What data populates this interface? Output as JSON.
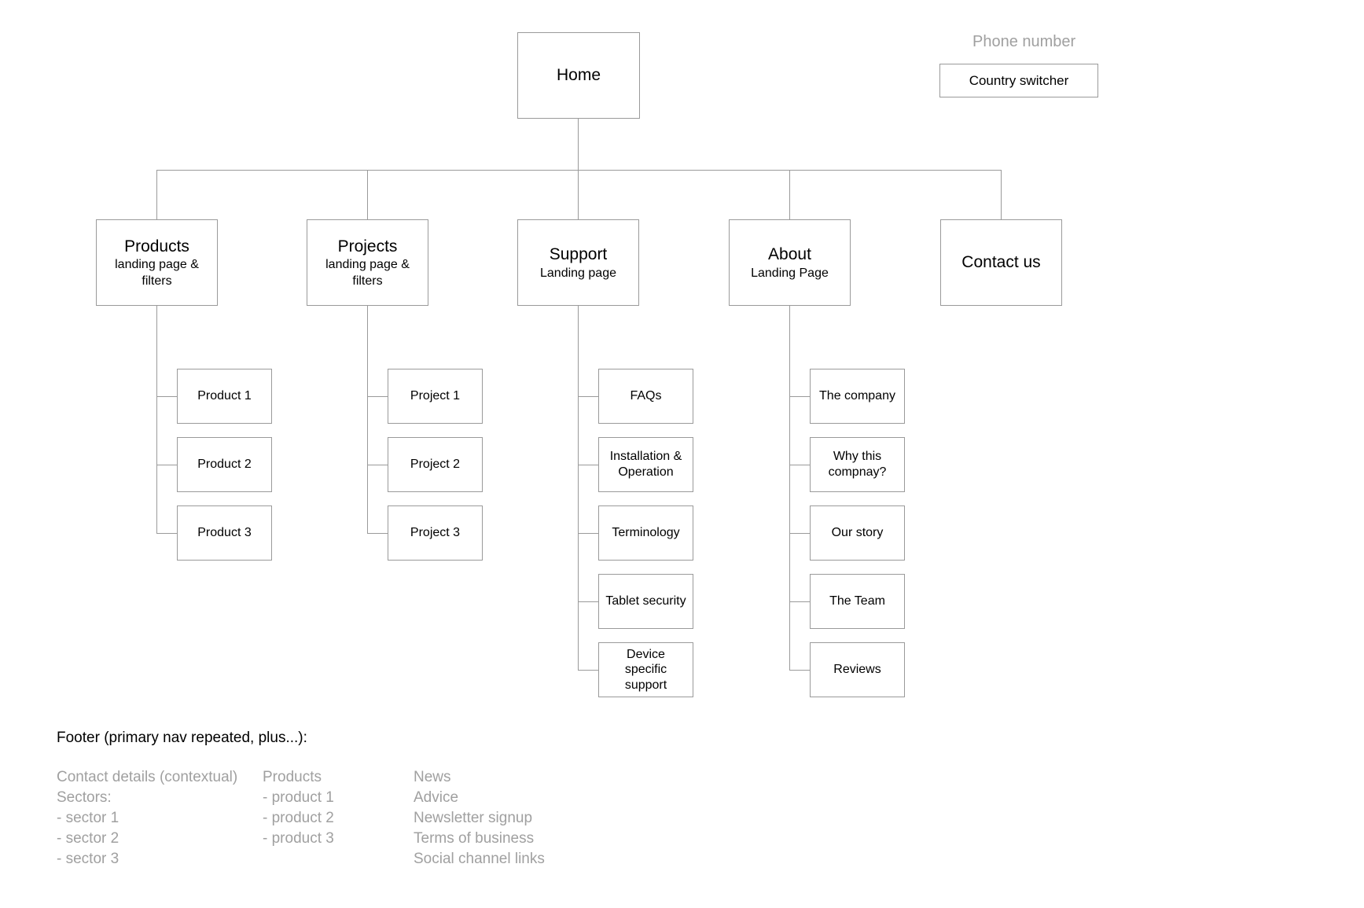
{
  "diagram": {
    "type": "sitemap-tree",
    "root": {
      "label": "Home"
    },
    "header_extras": {
      "phone_number": "Phone number",
      "country_switcher": "Country switcher"
    },
    "level2": [
      {
        "label": "Products",
        "sub_line1": "landing page &",
        "sub_line2": "filters"
      },
      {
        "label": "Projects",
        "sub_line1": "landing page &",
        "sub_line2": "filters"
      },
      {
        "label": "Support",
        "sub_line1": "Landing page",
        "sub_line2": ""
      },
      {
        "label": "About",
        "sub_line1": "Landing Page",
        "sub_line2": ""
      },
      {
        "label": "Contact us",
        "sub_line1": "",
        "sub_line2": ""
      }
    ],
    "products_children": [
      {
        "label": "Product 1"
      },
      {
        "label": "Product 2"
      },
      {
        "label": "Product 3"
      }
    ],
    "projects_children": [
      {
        "label": "Project 1"
      },
      {
        "label": "Project 2"
      },
      {
        "label": "Project 3"
      }
    ],
    "support_children": [
      {
        "line1": "FAQs",
        "line2": "",
        "line3": ""
      },
      {
        "line1": "Installation &",
        "line2": "Operation",
        "line3": ""
      },
      {
        "line1": "Terminology",
        "line2": "",
        "line3": ""
      },
      {
        "line1": "Tablet security",
        "line2": "",
        "line3": ""
      },
      {
        "line1": "Device",
        "line2": "specific",
        "line3": "support"
      }
    ],
    "about_children": [
      {
        "line1": "The company",
        "line2": ""
      },
      {
        "line1": "Why this",
        "line2": "compnay?"
      },
      {
        "line1": "Our story",
        "line2": ""
      },
      {
        "line1": "The Team",
        "line2": ""
      },
      {
        "line1": "Reviews",
        "line2": ""
      }
    ]
  },
  "footer": {
    "heading": "Footer (primary nav repeated, plus...):",
    "columns": [
      {
        "lines": [
          "Contact details (contextual)",
          "Sectors:",
          "- sector 1",
          "- sector 2",
          "- sector 3"
        ]
      },
      {
        "lines": [
          "Products",
          "- product 1",
          "- product 2",
          "- product 3"
        ]
      },
      {
        "lines": [
          "News",
          "Advice",
          "Newsletter signup",
          "Terms of business",
          "Social channel links"
        ]
      }
    ]
  },
  "colors": {
    "stroke": "#9a9a9a",
    "text": "#000000",
    "muted_text": "#a0a0a0",
    "background": "#ffffff"
  }
}
